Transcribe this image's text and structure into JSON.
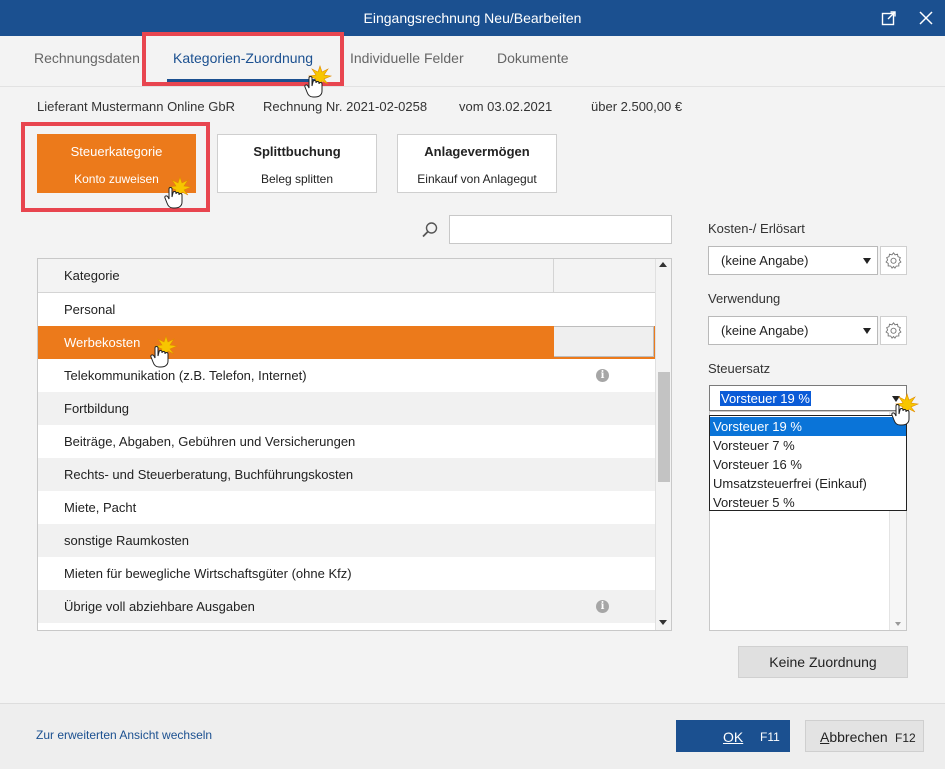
{
  "window": {
    "title": "Eingangsrechnung Neu/Bearbeiten"
  },
  "tabs": [
    {
      "label": "Rechnungsdaten",
      "active": false
    },
    {
      "label": "Kategorien-Zuordnung",
      "active": true
    },
    {
      "label": "Individuelle Felder",
      "active": false
    },
    {
      "label": "Dokumente",
      "active": false
    }
  ],
  "invoice_info": {
    "supplier": "Lieferant Mustermann Online GbR",
    "invoice_no": "Rechnung Nr. 2021-02-0258",
    "date": "vom 03.02.2021",
    "amount": "über 2.500,00 €"
  },
  "mode_buttons": [
    {
      "title": "Steuerkategorie",
      "subtitle": "Konto zuweisen",
      "active": true
    },
    {
      "title": "Splittbuchung",
      "subtitle": "Beleg splitten",
      "active": false
    },
    {
      "title": "Anlagevermögen",
      "subtitle": "Einkauf von Anlagegut",
      "active": false
    }
  ],
  "search": {
    "value": "",
    "placeholder": ""
  },
  "category_table": {
    "header": "Kategorie",
    "rows": [
      {
        "label": "Personal",
        "info": false
      },
      {
        "label": "Werbekosten",
        "info": false,
        "selected": true
      },
      {
        "label": "Telekommunikation (z.B. Telefon, Internet)",
        "info": true
      },
      {
        "label": "Fortbildung",
        "info": false
      },
      {
        "label": "Beiträge, Abgaben, Gebühren und Versicherungen",
        "info": false
      },
      {
        "label": "Rechts- und Steuerberatung, Buchführungskosten",
        "info": false
      },
      {
        "label": "Miete, Pacht",
        "info": false
      },
      {
        "label": "sonstige Raumkosten",
        "info": false
      },
      {
        "label": "Mieten für bewegliche Wirtschaftsgüter (ohne Kfz)",
        "info": false
      },
      {
        "label": "Übrige voll abziehbare Ausgaben",
        "info": true
      }
    ]
  },
  "right_panel": {
    "cost_label": "Kosten-/ Erlösart",
    "cost_value": "(keine Angabe)",
    "usage_label": "Verwendung",
    "usage_value": "(keine Angabe)",
    "tax_label": "Steuersatz",
    "tax_value": "Vorsteuer 19 %",
    "tax_options": [
      "Vorsteuer 19 %",
      "Vorsteuer 7 %",
      "Vorsteuer 16 %",
      "Umsatzsteuerfrei (Einkauf)",
      "Vorsteuer 5 %"
    ],
    "no_assignment": "Keine Zuordnung"
  },
  "footer": {
    "extended_view_link": "Zur erweiterten Ansicht wechseln",
    "ok_label": "OK",
    "ok_key": "F11",
    "cancel_label": "Abbrechen",
    "cancel_key": "F12"
  },
  "colors": {
    "title_bar": "#1b5090",
    "accent_orange": "#ec7a1b",
    "highlight_frame": "#e8454f",
    "selection_blue": "#0a74d8"
  }
}
